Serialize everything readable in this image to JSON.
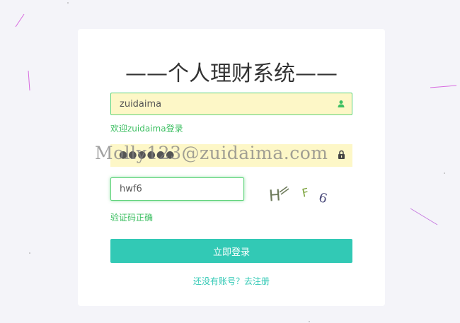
{
  "title": "——个人理财系统——",
  "username": {
    "value": "zuidaima",
    "icon": "user-icon",
    "hint": "欢迎zuidaima登录"
  },
  "password": {
    "masked": "●●●●●●",
    "icon": "lock-icon"
  },
  "watermark": "Molly123@zuidaima.com",
  "captcha": {
    "value": "hwf6",
    "chars": [
      "H",
      "F",
      "6"
    ],
    "hint": "验证码正确"
  },
  "login_button": "立即登录",
  "register_link": "还没有账号？去注册",
  "colors": {
    "accent": "#32c9b5",
    "success": "#3dbf62",
    "autofill": "#fdf7c7"
  }
}
